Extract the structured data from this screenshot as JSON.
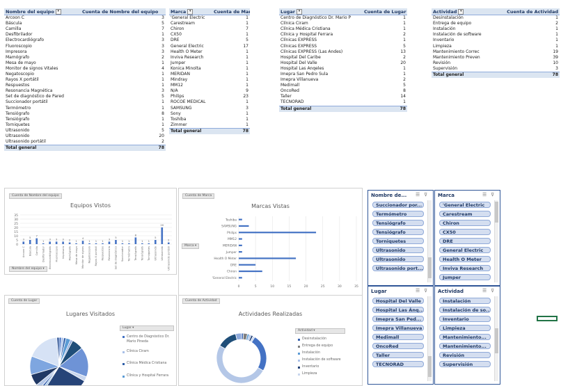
{
  "pivots": {
    "equipo": {
      "headers": [
        "Nombre del equipo",
        "Cuenta de Nombre del equipo"
      ],
      "rows": [
        [
          "Arcoon C",
          "3"
        ],
        [
          "Báscula",
          "5"
        ],
        [
          "Camilla",
          "7"
        ],
        [
          "Desfibrilador",
          "1"
        ],
        [
          "Electrocardiógrafo",
          "3"
        ],
        [
          "Fluoroscopio",
          "3"
        ],
        [
          "Impresora",
          "3"
        ],
        [
          "Mamógrafo",
          "2"
        ],
        [
          "Mesa de mayo",
          "1"
        ],
        [
          "Monitor de signos Vitales",
          "4"
        ],
        [
          "Negatoscopio",
          "1"
        ],
        [
          "Rayos X portátil",
          "1"
        ],
        [
          "Respuestos",
          "1"
        ],
        [
          "Resonancia Magnética",
          "3"
        ],
        [
          "Set de diagnóstico de Pared",
          "5"
        ],
        [
          "Succionador portátil",
          "1"
        ],
        [
          "Termómetro",
          "1"
        ],
        [
          "Tensiógrafo",
          "8"
        ],
        [
          "Tensiógrafo",
          "1"
        ],
        [
          "Torniquetes",
          "1"
        ],
        [
          "Ultrasonido",
          "5"
        ],
        [
          "Ultrasonido",
          "20"
        ],
        [
          "Ultrasonido portátil",
          "2"
        ]
      ],
      "total_label": "Total general",
      "total": "78"
    },
    "marca": {
      "headers": [
        "Marca",
        "Cuenta de Marca"
      ],
      "rows": [
        [
          "'General Electric",
          "1"
        ],
        [
          "Carestream",
          "1"
        ],
        [
          "Chiron",
          "7"
        ],
        [
          "CX50",
          "1"
        ],
        [
          "DRE",
          "5"
        ],
        [
          "General Electric",
          "17"
        ],
        [
          "Health O Meter",
          "1"
        ],
        [
          "Inviva Research",
          "1"
        ],
        [
          "Jumper",
          "1"
        ],
        [
          "Konica Minolta",
          "1"
        ],
        [
          "MERIDAN",
          "1"
        ],
        [
          "Mindray",
          "1"
        ],
        [
          "MM12",
          "1"
        ],
        [
          "N/A",
          "9"
        ],
        [
          "Philips",
          "23"
        ],
        [
          "ROCOE MEDICAL",
          "1"
        ],
        [
          "SAMSUNG",
          "3"
        ],
        [
          "Sony",
          "1"
        ],
        [
          "Toshiba",
          "1"
        ],
        [
          "Zimmer",
          "1"
        ]
      ],
      "total_label": "Total general",
      "total": "78"
    },
    "lugar": {
      "headers": [
        "Lugar",
        "Cuenta de Lugar"
      ],
      "rows": [
        [
          "Centro de Diagnóstico Dr. Mario P",
          "1"
        ],
        [
          "Clínica Ciram",
          "1"
        ],
        [
          "Clínica Médica Cristiana",
          "1"
        ],
        [
          "Clínica y Hospital Ferrara",
          "2"
        ],
        [
          "Clínicas EXPRESS",
          "1"
        ],
        [
          "Clínicas EXPRESS",
          "5"
        ],
        [
          "Clínicas EXPRESS (Las Andes)",
          "13"
        ],
        [
          "Hospital Del Caribe",
          "2"
        ],
        [
          "Hospital Del Valle",
          "20"
        ],
        [
          "Hospital Las Ánqeles",
          "1"
        ],
        [
          "Imepra San Pedro Sula",
          "1"
        ],
        [
          "Imepra Villanueva",
          "2"
        ],
        [
          "Medimall",
          "5"
        ],
        [
          "OncoRed",
          "8"
        ],
        [
          "Taller",
          "14"
        ],
        [
          "TECNORAD",
          "1"
        ]
      ],
      "total_label": "Total general",
      "total": "78"
    },
    "actividad": {
      "headers": [
        "Actividad",
        "Cuenta de Actividad"
      ],
      "rows": [
        [
          "Desinstalación",
          "1"
        ],
        [
          "Entrega de equipo",
          "2"
        ],
        [
          "Instalación",
          "1"
        ],
        [
          "Instalación de software",
          "1"
        ],
        [
          "Inventario",
          "1"
        ],
        [
          "Limpieza",
          "1"
        ],
        [
          "Mantenimiento Correc",
          "19"
        ],
        [
          "Mantenimiento Preven",
          "39"
        ],
        [
          "Revisión",
          "10"
        ],
        [
          "Supervisión",
          "3"
        ]
      ],
      "total_label": "Total general",
      "total": "78"
    }
  },
  "charts": {
    "equipos": {
      "field_button": "Cuenta de Nombre del equipo",
      "axis_button": "Nombre del equipo",
      "title": "Equipos Vistos"
    },
    "marcas": {
      "field_button": "Cuenta de Marca",
      "axis_button": "Marca",
      "title": "Marcas Vistas"
    },
    "lugares": {
      "field_button": "Cuenta de Lugar",
      "legend_button": "Lugar",
      "title": "Lugares Visitados",
      "legend": [
        "Centro de Diagnóstico Dr. Mario Pineda",
        "Clínica Ciram",
        "Clínica Médica Cristiana",
        "Clínica y Hospital Ferrara"
      ]
    },
    "actividades": {
      "field_button": "Cuenta de Actividad",
      "legend_button": "Actividad",
      "title": "Actividades Realizadas",
      "legend": [
        "Desinstalación",
        "Entrega de equipo",
        "Instalación",
        "Instalación de software",
        "Inventario",
        "Limpieza"
      ]
    }
  },
  "chart_data": [
    {
      "type": "bar",
      "title": "Equipos Vistos",
      "categories": [
        "Arcoon C",
        "Báscula",
        "Camilla",
        "Desfibrilador",
        "Electrocardiógrafo",
        "Fluoroscopio",
        "Impresora",
        "Mamógrafo",
        "Mesa de mayo",
        "Monitor de signos",
        "Negatoscopio",
        "Rayos X portátil",
        "Respuestos",
        "Resonancia",
        "Set de diagnóstico",
        "Succionador",
        "Termómetro",
        "Tensiógrafo",
        "Tensiógrafo",
        "Torniquetes",
        "Ultrasonido",
        "Ultrasonido",
        "Ultrasonido portátil"
      ],
      "values": [
        3,
        5,
        7,
        1,
        3,
        3,
        3,
        2,
        1,
        4,
        1,
        1,
        1,
        3,
        5,
        1,
        1,
        8,
        1,
        1,
        5,
        20,
        2
      ],
      "ylim": [
        0,
        35
      ],
      "yticks": [
        "0",
        "5",
        "10",
        "15",
        "20",
        "25",
        "30",
        "35"
      ]
    },
    {
      "type": "bar",
      "orientation": "horizontal",
      "title": "Marcas Vistas",
      "categories": [
        "'General Electric",
        "Chiron",
        "DRE",
        "Health O Meter",
        "Jumper",
        "MERIDAN",
        "MM12",
        "Philips",
        "SAMSUNG",
        "Toshiba"
      ],
      "values": [
        1,
        7,
        5,
        17,
        1,
        1,
        1,
        23,
        3,
        1
      ],
      "xlim": [
        0,
        35
      ],
      "xticks": [
        "0",
        "5",
        "10",
        "15",
        "20",
        "25",
        "30",
        "35"
      ]
    },
    {
      "type": "pie",
      "title": "Lugares Visitados",
      "categories": [
        "Centro de Diagnóstico Dr. Mario Pineda",
        "Clínica Ciram",
        "Clínica Médica Cristiana",
        "Clínica y Hospital Ferrara",
        "Clínicas EXPRESS",
        "Clínicas EXPRESS",
        "Clínicas EXPRESS (Las Andes)",
        "Hospital Del Caribe",
        "Hospital Del Valle",
        "Hospital Las Ánqeles",
        "Imepra San Pedro Sula",
        "Imepra Villanueva",
        "Medimall",
        "OncoRed",
        "Taller",
        "TECNORAD"
      ],
      "values": [
        1,
        1,
        1,
        2,
        1,
        5,
        13,
        2,
        20,
        1,
        1,
        2,
        5,
        8,
        14,
        1
      ]
    },
    {
      "type": "pie",
      "subtype": "doughnut",
      "title": "Actividades Realizadas",
      "categories": [
        "Desinstalación",
        "Entrega de equipo",
        "Instalación",
        "Instalación de software",
        "Inventario",
        "Limpieza",
        "Mantenimiento Correc",
        "Mantenimiento Preven",
        "Revisión",
        "Supervisión"
      ],
      "values": [
        1,
        2,
        1,
        1,
        1,
        1,
        19,
        39,
        10,
        3
      ]
    }
  ],
  "slicers": {
    "nombre": {
      "title": "Nombre de...",
      "items": [
        "Succionador por...",
        "Termómetro",
        "Tensiógrafo",
        "Tensiógrafo",
        "Torniquetes",
        "Ultrasonido",
        "Ultrasonido",
        "Ultrasonido port..."
      ]
    },
    "marca": {
      "title": "Marca",
      "items": [
        "'General Electric",
        "Carestream",
        "Chiron",
        "CX50",
        "DRE",
        "General Electric",
        "Health O Meter",
        "Inviva Research",
        "Jumper"
      ]
    },
    "lugar": {
      "title": "Lugar",
      "items": [
        "Hospital Del Valle",
        "Hospital Las Ánq...",
        "Imepra San Ped...",
        "Imepra Villanueva",
        "Medimall",
        "OncoRed",
        "Taller",
        "TECNORAD"
      ]
    },
    "actividad": {
      "title": "Actividad",
      "items": [
        "Instalación",
        "Instalación de so...",
        "Inventario",
        "Limpieza",
        "Mantenimiento...",
        "Mantenimiento...",
        "Revisión",
        "Supervisión"
      ]
    }
  },
  "colors": {
    "series": "#4472c4",
    "slicer_item": "#d4def0",
    "slicer_border": "#2f5597",
    "pivot_header": "#dbe5f1",
    "active_cell": "#217346"
  }
}
